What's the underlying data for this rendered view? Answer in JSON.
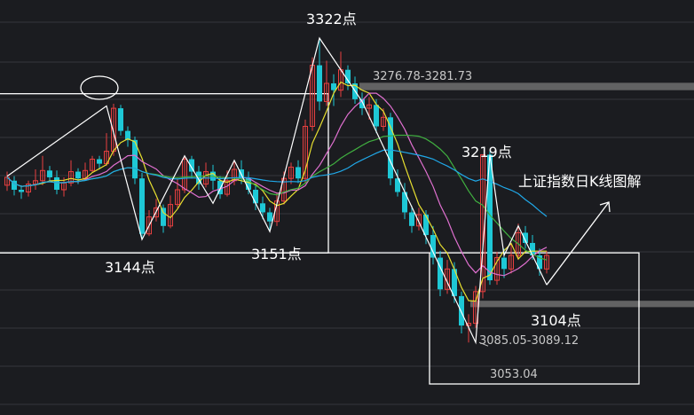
{
  "colors": {
    "background": "#1b1c20",
    "grid": "#34363c",
    "candle_up": "#e84040",
    "candle_down": "#1ec8d6",
    "ma_yellow": "#e8e030",
    "ma_pink": "#e070d0",
    "ma_green": "#40b040",
    "ma_blue": "#20a8e8",
    "annotation": "#ffffff",
    "level_band": "#6a6a6a"
  },
  "annotations": {
    "peak_3322": "3322点",
    "low_3144": "3144点",
    "low_3151": "3151点",
    "label_3219": "3219点",
    "low_3104": "3104点",
    "title": "上证指数日K线图解",
    "band_upper": "3276.78-3281.73",
    "band_lower": "3085.05-3089.12",
    "low_3053": "3053.04"
  },
  "chart_data": {
    "type": "candlestick",
    "title": "上证指数日K线图解",
    "price_range": [
      3025,
      3340
    ],
    "key_points": [
      {
        "label": "3144点",
        "value": 3144
      },
      {
        "label": "3151点",
        "value": 3151
      },
      {
        "label": "3322点",
        "value": 3322
      },
      {
        "label": "3219点",
        "value": 3219
      },
      {
        "label": "3104点",
        "value": 3104
      },
      {
        "label": "3053.04",
        "value": 3053.04
      }
    ],
    "resistance_band": [
      3276.78,
      3281.73
    ],
    "support_band": [
      3085.05,
      3089.12
    ],
    "candles": [
      [
        3192,
        3199,
        3187,
        3204
      ],
      [
        3196,
        3188,
        3183,
        3200
      ],
      [
        3188,
        3186,
        3180,
        3192
      ],
      [
        3186,
        3193,
        3182,
        3196
      ],
      [
        3193,
        3196,
        3188,
        3206
      ],
      [
        3196,
        3205,
        3192,
        3218
      ],
      [
        3205,
        3199,
        3196,
        3209
      ],
      [
        3199,
        3188,
        3184,
        3205
      ],
      [
        3188,
        3194,
        3182,
        3199
      ],
      [
        3194,
        3204,
        3191,
        3214
      ],
      [
        3204,
        3198,
        3193,
        3207
      ],
      [
        3198,
        3205,
        3196,
        3212
      ],
      [
        3205,
        3215,
        3203,
        3218
      ],
      [
        3215,
        3211,
        3206,
        3218
      ],
      [
        3211,
        3222,
        3209,
        3238
      ],
      [
        3222,
        3260,
        3218,
        3264
      ],
      [
        3260,
        3240,
        3236,
        3263
      ],
      [
        3240,
        3232,
        3226,
        3244
      ],
      [
        3232,
        3198,
        3193,
        3235
      ],
      [
        3198,
        3149,
        3144,
        3203
      ],
      [
        3149,
        3164,
        3147,
        3170
      ],
      [
        3164,
        3172,
        3160,
        3180
      ],
      [
        3172,
        3156,
        3150,
        3175
      ],
      [
        3156,
        3175,
        3154,
        3183
      ],
      [
        3175,
        3188,
        3172,
        3198
      ],
      [
        3188,
        3215,
        3185,
        3218
      ],
      [
        3215,
        3204,
        3198,
        3218
      ],
      [
        3204,
        3193,
        3188,
        3209
      ],
      [
        3193,
        3204,
        3190,
        3212
      ],
      [
        3204,
        3196,
        3188,
        3210
      ],
      [
        3196,
        3184,
        3180,
        3200
      ],
      [
        3184,
        3196,
        3182,
        3205
      ],
      [
        3196,
        3206,
        3192,
        3214
      ],
      [
        3206,
        3198,
        3193,
        3214
      ],
      [
        3198,
        3188,
        3184,
        3204
      ],
      [
        3188,
        3176,
        3170,
        3192
      ],
      [
        3176,
        3168,
        3162,
        3182
      ],
      [
        3168,
        3160,
        3151,
        3172
      ],
      [
        3160,
        3178,
        3156,
        3185
      ],
      [
        3178,
        3198,
        3175,
        3204
      ],
      [
        3198,
        3208,
        3193,
        3212
      ],
      [
        3208,
        3198,
        3194,
        3214
      ],
      [
        3198,
        3244,
        3194,
        3250
      ],
      [
        3244,
        3298,
        3240,
        3305
      ],
      [
        3298,
        3266,
        3258,
        3322
      ],
      [
        3266,
        3282,
        3262,
        3302
      ],
      [
        3282,
        3276,
        3262,
        3290
      ],
      [
        3276,
        3294,
        3270,
        3310
      ],
      [
        3294,
        3282,
        3276,
        3298
      ],
      [
        3282,
        3268,
        3264,
        3288
      ],
      [
        3268,
        3260,
        3254,
        3274
      ],
      [
        3260,
        3263,
        3250,
        3270
      ],
      [
        3263,
        3244,
        3238,
        3268
      ],
      [
        3244,
        3252,
        3240,
        3260
      ],
      [
        3252,
        3198,
        3192,
        3256
      ],
      [
        3198,
        3186,
        3182,
        3206
      ],
      [
        3186,
        3168,
        3162,
        3194
      ],
      [
        3168,
        3156,
        3150,
        3174
      ],
      [
        3156,
        3166,
        3152,
        3172
      ],
      [
        3166,
        3148,
        3140,
        3170
      ],
      [
        3148,
        3128,
        3122,
        3156
      ],
      [
        3128,
        3100,
        3094,
        3134
      ],
      [
        3100,
        3118,
        3096,
        3126
      ],
      [
        3118,
        3094,
        3088,
        3124
      ],
      [
        3094,
        3068,
        3061,
        3098
      ],
      [
        3068,
        3070,
        3053,
        3078
      ],
      [
        3070,
        3098,
        3066,
        3103
      ],
      [
        3098,
        3219,
        3092,
        3219
      ],
      [
        3219,
        3108,
        3104,
        3222
      ],
      [
        3108,
        3128,
        3104,
        3133
      ],
      [
        3128,
        3118,
        3110,
        3136
      ],
      [
        3118,
        3130,
        3114,
        3140
      ],
      [
        3130,
        3150,
        3126,
        3158
      ],
      [
        3150,
        3141,
        3136,
        3156
      ],
      [
        3141,
        3130,
        3126,
        3148
      ],
      [
        3130,
        3118,
        3112,
        3136
      ],
      [
        3118,
        3130,
        3114,
        3134
      ]
    ]
  }
}
